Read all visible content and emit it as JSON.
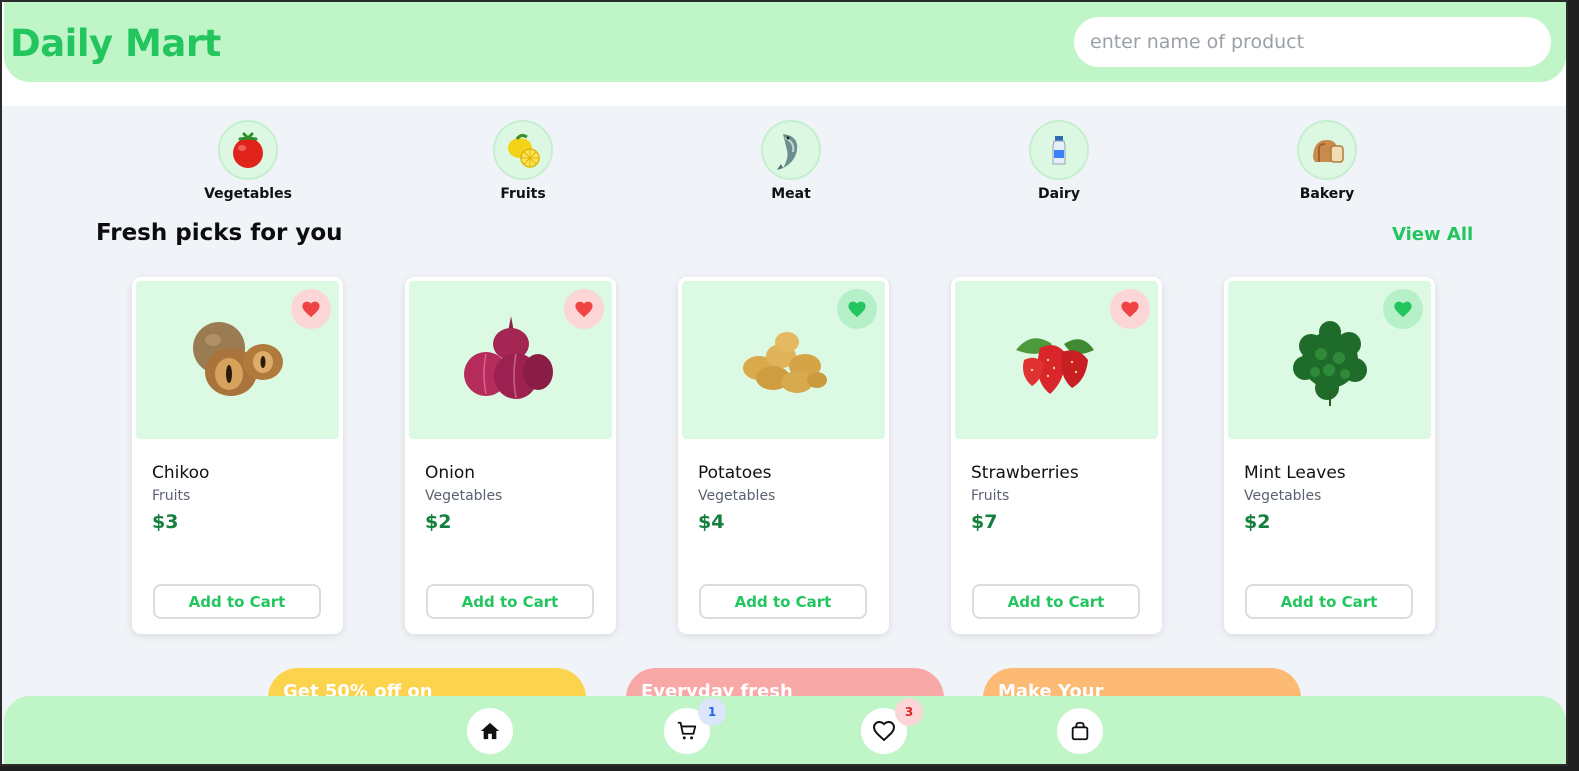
{
  "header": {
    "brand": "Daily Mart",
    "search_placeholder": "enter name of product"
  },
  "categories": [
    {
      "label": "Vegetables",
      "icon": "tomato-icon"
    },
    {
      "label": "Fruits",
      "icon": "lemon-icon"
    },
    {
      "label": "Meat",
      "icon": "fish-icon"
    },
    {
      "label": "Dairy",
      "icon": "milk-bottle-icon"
    },
    {
      "label": "Bakery",
      "icon": "bread-icon"
    }
  ],
  "section": {
    "title": "Fresh picks for you",
    "view_all": "View All"
  },
  "products": [
    {
      "name": "Chikoo",
      "category": "Fruits",
      "price": "$3",
      "button": "Add to Cart",
      "favorite_color": "red"
    },
    {
      "name": "Onion",
      "category": "Vegetables",
      "price": "$2",
      "button": "Add to Cart",
      "favorite_color": "red"
    },
    {
      "name": "Potatoes",
      "category": "Vegetables",
      "price": "$4",
      "button": "Add to Cart",
      "favorite_color": "green"
    },
    {
      "name": "Strawberries",
      "category": "Fruits",
      "price": "$7",
      "button": "Add to Cart",
      "favorite_color": "red"
    },
    {
      "name": "Mint Leaves",
      "category": "Vegetables",
      "price": "$2",
      "button": "Add to Cart",
      "favorite_color": "green"
    }
  ],
  "promos": [
    {
      "text": "Get 50% off on",
      "color": "#fcd34d"
    },
    {
      "text": "Everyday fresh",
      "color": "#f9a8a8"
    },
    {
      "text": "Make Your",
      "color": "#fdba74"
    }
  ],
  "bottom_nav": {
    "home_icon": "home-icon",
    "cart_icon": "cart-icon",
    "cart_count": "1",
    "wishlist_icon": "heart-icon",
    "wishlist_count": "3",
    "bag_icon": "shopping-bag-icon"
  },
  "colors": {
    "brand_green": "#22c55e",
    "header_bg": "#c0f5c8",
    "price_green": "#15803d",
    "fav_red": "#ef4444",
    "fav_green": "#22c55e"
  }
}
